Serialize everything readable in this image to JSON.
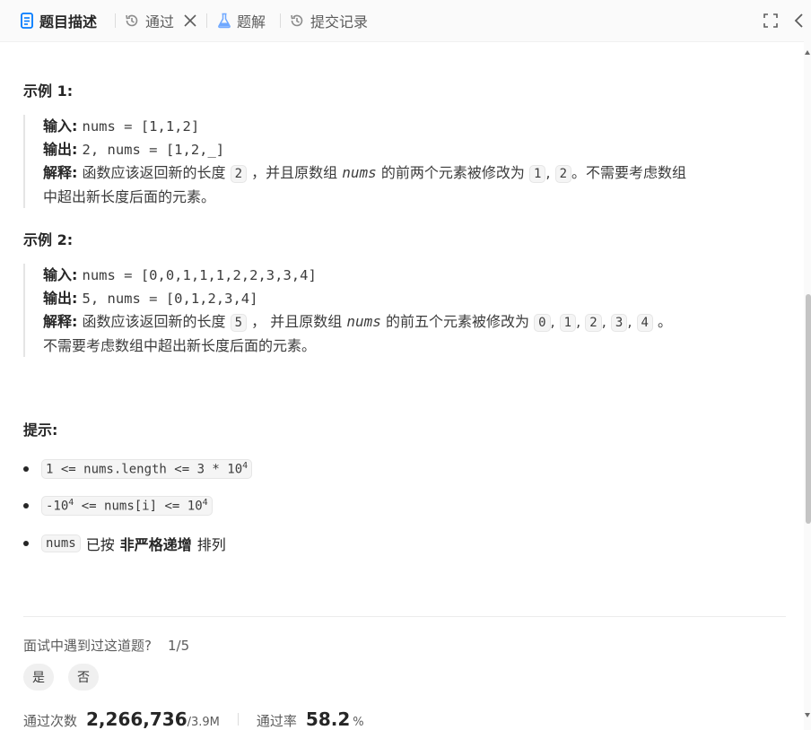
{
  "tabs": [
    {
      "label": "题目描述",
      "icon": "document-icon",
      "active": true
    },
    {
      "label": "通过",
      "icon": "history-icon",
      "active": false
    },
    {
      "label": "题解",
      "icon": "flask-icon",
      "active": false
    },
    {
      "label": "提交记录",
      "icon": "history-icon",
      "active": false
    }
  ],
  "examples": [
    {
      "title": "示例 1:",
      "input_label": "输入:",
      "input": "nums = [1,1,2]",
      "output_label": "输出:",
      "output": "2, nums = [1,2,_]",
      "explain_label": "解释:",
      "explain_a": "函数应该返回新的长度",
      "explain_len": "2",
      "explain_b": "，并且原数组",
      "explain_var": "nums",
      "explain_c": "的前两个元素被修改为",
      "vals": [
        "1",
        "2"
      ],
      "explain_tail": "。不需要考虑数组",
      "explain_line2": "中超出新长度后面的元素。"
    },
    {
      "title": "示例 2:",
      "input_label": "输入:",
      "input": "nums = [0,0,1,1,1,2,2,3,3,4]",
      "output_label": "输出:",
      "output": "5, nums = [0,1,2,3,4]",
      "explain_label": "解释:",
      "explain_a": "函数应该返回新的长度",
      "explain_len": "5",
      "explain_b": "， 并且原数组",
      "explain_var": "nums",
      "explain_c": "的前五个元素被修改为",
      "vals": [
        "0",
        "1",
        "2",
        "3",
        "4"
      ],
      "explain_tail": "。",
      "explain_line2": "不需要考虑数组中超出新长度后面的元素。"
    }
  ],
  "hints": {
    "title": "提示:",
    "c1": {
      "a": "1 <= nums.length <= 3 * 10",
      "sup": "4"
    },
    "c2": {
      "a": "-10",
      "sup1": "4",
      "b": " <= nums[i] <= 10",
      "sup2": "4"
    },
    "c3": {
      "code": "nums",
      "a": "已按",
      "bold": "非严格递增",
      "b": "排列"
    }
  },
  "interview": {
    "question": "面试中遇到过这道题?",
    "count": "1/5",
    "yes": "是",
    "no": "否"
  },
  "stats": {
    "accepted_label": "通过次数",
    "accepted": "2,266,736",
    "total": "/3.9M",
    "rate_label": "通过率",
    "rate": "58.2",
    "rate_unit": "%"
  },
  "colors": {
    "accent": "#007aff",
    "muted": "#5c5c5c"
  }
}
